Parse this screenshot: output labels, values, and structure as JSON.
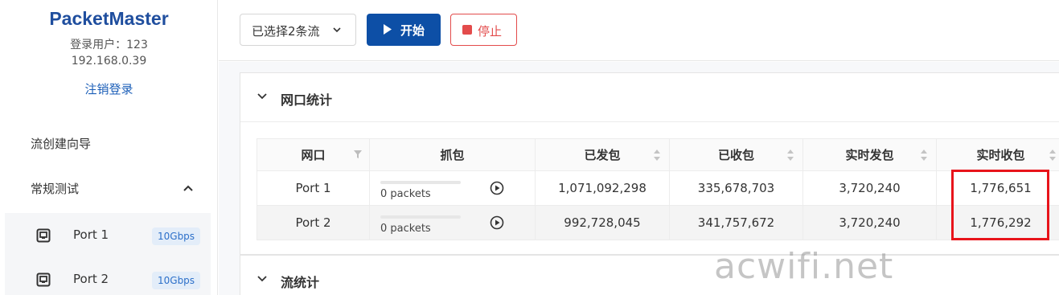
{
  "app": {
    "brand": "PacketMaster"
  },
  "user": {
    "label": "登录用户：123",
    "ip": "192.168.0.39",
    "logout": "注销登录"
  },
  "nav": {
    "wizard": "流创建向导",
    "regular": "常规测试",
    "ports": [
      {
        "label": "Port 1",
        "badge": "10Gbps"
      },
      {
        "label": "Port 2",
        "badge": "10Gbps"
      }
    ]
  },
  "toolbar": {
    "select_value": "已选择2条流",
    "start": "开始",
    "stop": "停止"
  },
  "sections": {
    "port_stats": "网口统计",
    "flow_stats": "流统计"
  },
  "table": {
    "headers": [
      "网口",
      "抓包",
      "已发包",
      "已收包",
      "实时发包",
      "实时收包"
    ],
    "rows": [
      {
        "port": "Port 1",
        "capture": "0 packets",
        "capture_progress": 0,
        "sent": "1,071,092,298",
        "received": "335,678,703",
        "rt_sent": "3,720,240",
        "rt_received": "1,776,651"
      },
      {
        "port": "Port 2",
        "capture": "0 packets",
        "capture_progress": 0,
        "sent": "992,728,045",
        "received": "341,757,672",
        "rt_sent": "3,720,240",
        "rt_received": "1,776,292"
      }
    ]
  },
  "watermark": "acwifi.net",
  "colors": {
    "brand": "#1f4e9e",
    "primary": "#0d4fa6",
    "danger": "#e34b4b",
    "highlight": "#e8141b"
  }
}
